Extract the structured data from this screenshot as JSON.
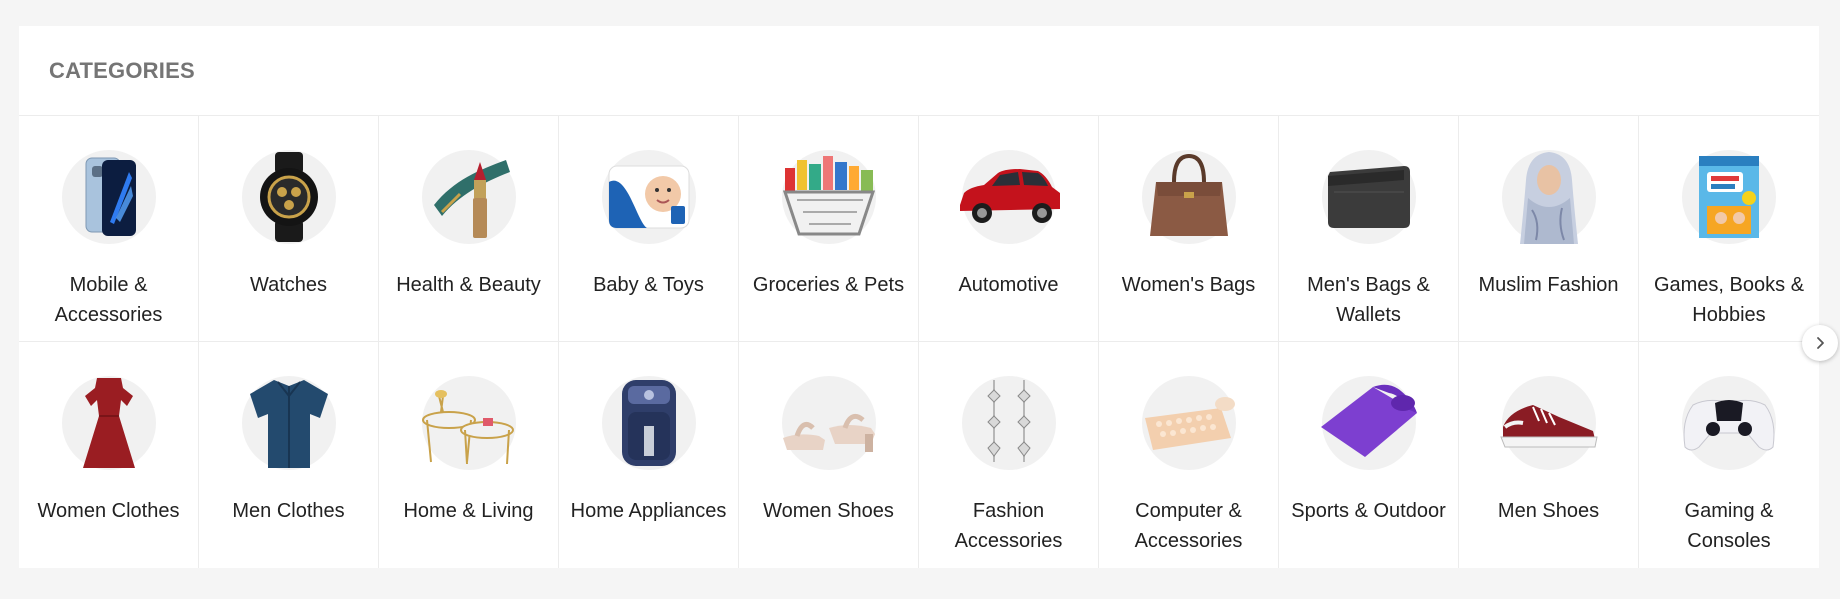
{
  "section": {
    "title": "CATEGORIES"
  },
  "categories": [
    {
      "label": "Mobile & Accessories",
      "icon": "smartphone-icon"
    },
    {
      "label": "Watches",
      "icon": "watch-icon"
    },
    {
      "label": "Health & Beauty",
      "icon": "lipstick-icon"
    },
    {
      "label": "Baby & Toys",
      "icon": "diaper-pack-icon"
    },
    {
      "label": "Groceries & Pets",
      "icon": "shopping-basket-icon"
    },
    {
      "label": "Automotive",
      "icon": "car-icon"
    },
    {
      "label": "Women's Bags",
      "icon": "handbag-icon"
    },
    {
      "label": "Men's Bags & Wallets",
      "icon": "wallet-icon"
    },
    {
      "label": "Muslim Fashion",
      "icon": "hijab-model-icon"
    },
    {
      "label": "Games, Books & Hobbies",
      "icon": "book-icon"
    },
    {
      "label": "Women Clothes",
      "icon": "dress-icon"
    },
    {
      "label": "Men Clothes",
      "icon": "shirt-icon"
    },
    {
      "label": "Home & Living",
      "icon": "coffee-table-icon"
    },
    {
      "label": "Home Appliances",
      "icon": "air-fryer-icon"
    },
    {
      "label": "Women Shoes",
      "icon": "sandals-icon"
    },
    {
      "label": "Fashion Accessories",
      "icon": "earrings-icon"
    },
    {
      "label": "Computer & Accessories",
      "icon": "keyboard-mouse-icon"
    },
    {
      "label": "Sports & Outdoor",
      "icon": "yoga-mat-icon"
    },
    {
      "label": "Men Shoes",
      "icon": "sneaker-icon"
    },
    {
      "label": "Gaming & Consoles",
      "icon": "game-controller-icon"
    }
  ],
  "carousel": {
    "next_icon": "chevron-right-icon"
  },
  "colors": {
    "page_bg": "#f5f5f5",
    "card_bg": "#ffffff",
    "divider": "#ececec",
    "title": "#757575",
    "thumb_bg": "#f1f1f1"
  }
}
